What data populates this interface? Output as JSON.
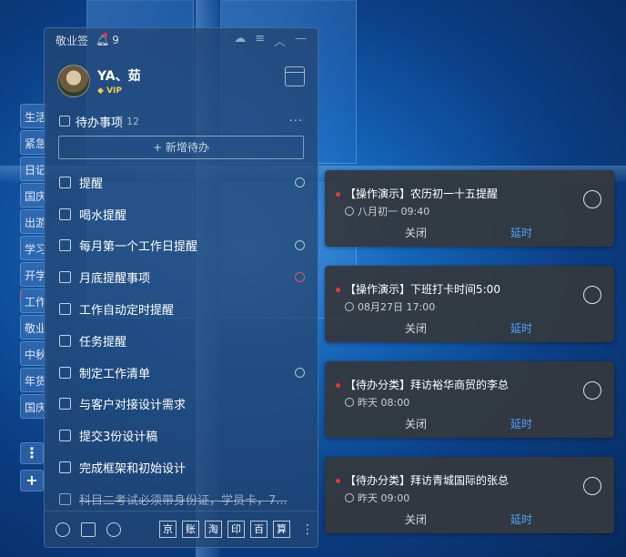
{
  "app": {
    "title": "敬业签",
    "notification_count": "9"
  },
  "user": {
    "name": "YA、茹",
    "badge": "VIP"
  },
  "side_tabs": [
    "生活",
    "紧急",
    "日记",
    "国庆",
    "出游",
    "学习",
    "开学",
    "工作",
    "敬业",
    "中秋",
    "年货",
    "国庆"
  ],
  "side_more": "⋮",
  "side_add": "+",
  "todo": {
    "header": "待办事项",
    "count": "12",
    "more": "···",
    "add_label": "+ 新增待办",
    "items": [
      {
        "text": "提醒",
        "clock": "normal"
      },
      {
        "text": "喝水提醒",
        "clock": "none"
      },
      {
        "text": "每月第一个工作日提醒",
        "clock": "normal"
      },
      {
        "text": "月底提醒事项",
        "clock": "red"
      },
      {
        "text": "工作自动定时提醒",
        "clock": "none"
      },
      {
        "text": "任务提醒",
        "clock": "none"
      },
      {
        "text": "制定工作清单",
        "clock": "normal"
      },
      {
        "text": "与客户对接设计需求",
        "clock": "none"
      },
      {
        "text": "提交3份设计稿",
        "clock": "none"
      },
      {
        "text": "完成框架和初始设计",
        "clock": "none"
      },
      {
        "text": "科目二考试必须带身份证，学员卡，7...",
        "clock": "none",
        "done": true
      }
    ]
  },
  "toolbar": {
    "tools": [
      "京",
      "账",
      "淘",
      "印",
      "百",
      "算"
    ],
    "more": "⋮"
  },
  "reminders": [
    {
      "title": "【操作演示】农历初一十五提醒",
      "time": "八月初一  09:40",
      "close": "关闭",
      "delay": "延时"
    },
    {
      "title": "【操作演示】下班打卡时间5:00",
      "time": "08月27日  17:00",
      "close": "关闭",
      "delay": "延时"
    },
    {
      "title": "【待办分类】拜访裕华商贸的李总",
      "time": "昨天  08:00",
      "close": "关闭",
      "delay": "延时"
    },
    {
      "title": "【待办分类】拜访青城国际的张总",
      "time": "昨天  09:00",
      "close": "关闭",
      "delay": "延时"
    }
  ],
  "colors": {
    "accent": "#4da3ff",
    "alert": "#e53935",
    "card_bg": "#34383e"
  }
}
